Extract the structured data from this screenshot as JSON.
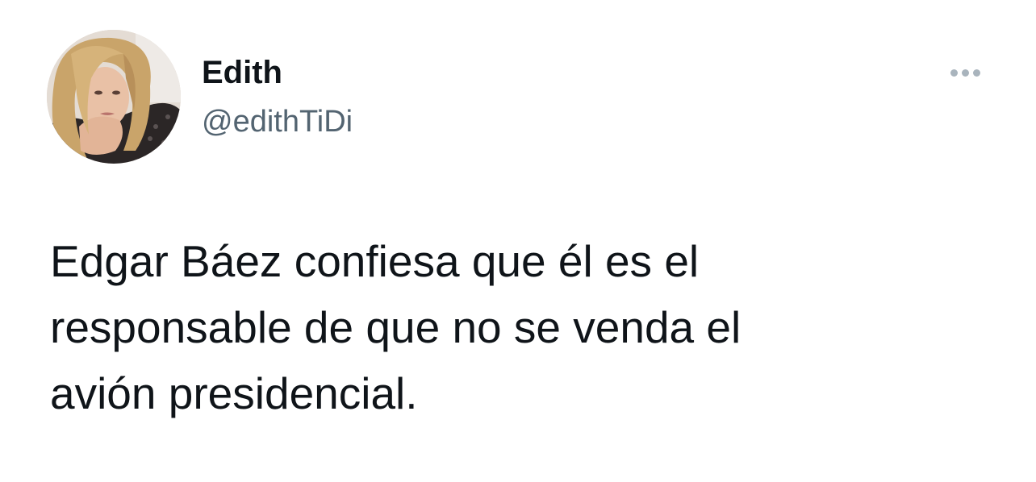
{
  "tweet": {
    "author": {
      "display_name": "Edith",
      "handle": "@edithTiDi"
    },
    "more_icon": "more-horizontal-icon",
    "text_lines": [
      "Edgar Báez confiesa que él es el",
      "responsable de que no se venda el",
      "avión presidencial."
    ]
  },
  "colors": {
    "text_primary": "#0f1419",
    "text_secondary": "#536471",
    "icon_muted": "#a9b4bd",
    "background": "#ffffff"
  }
}
